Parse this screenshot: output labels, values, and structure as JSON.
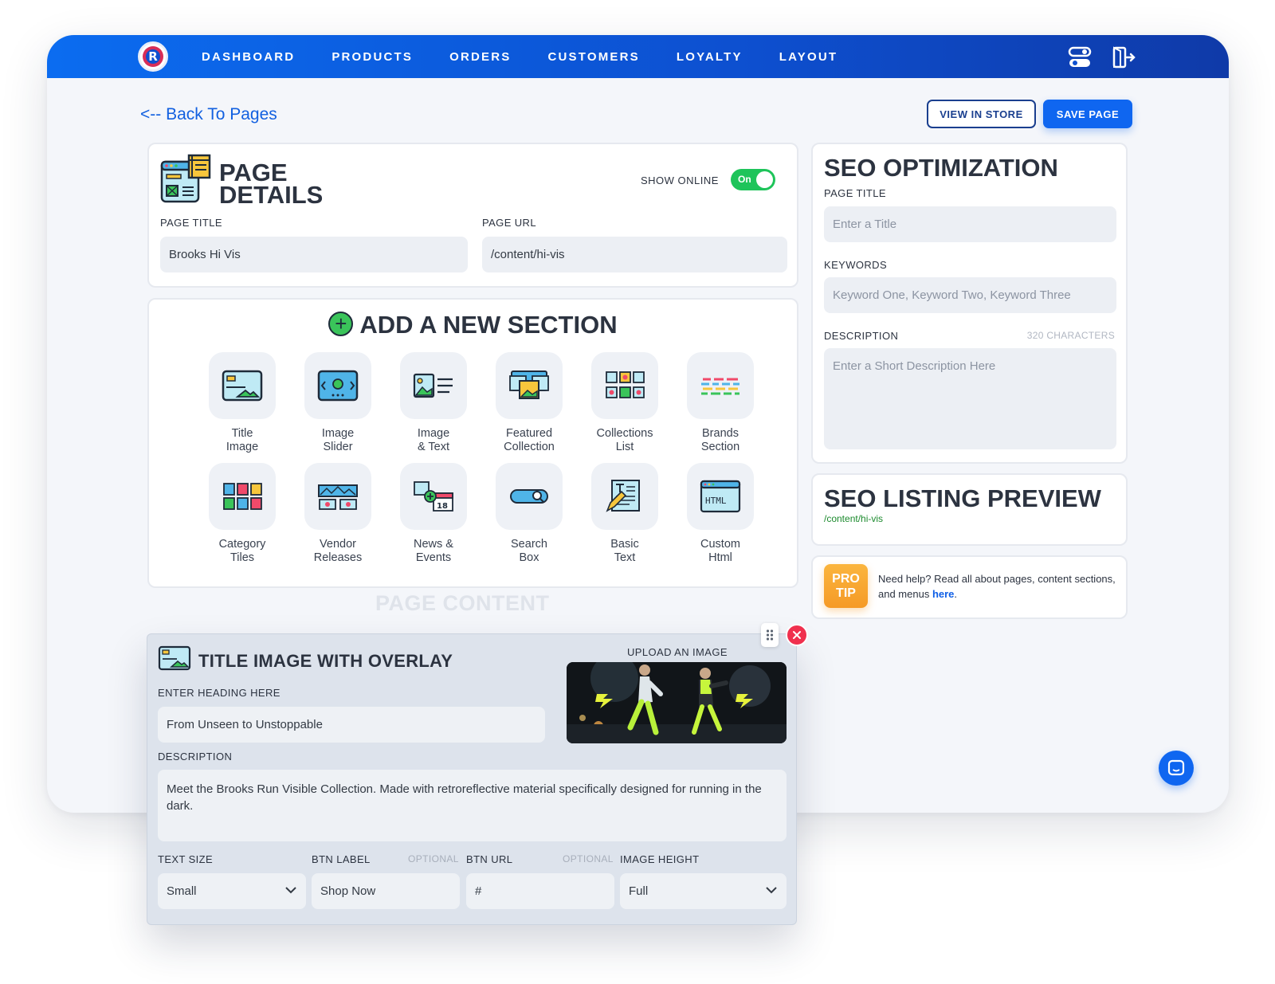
{
  "nav": {
    "items": [
      "DASHBOARD",
      "PRODUCTS",
      "ORDERS",
      "CUSTOMERS",
      "LOYALTY",
      "LAYOUT"
    ],
    "logo_letter": "R",
    "icons": [
      "settings-toggle-icon",
      "logout-icon"
    ]
  },
  "toolbar": {
    "back_label": "<-- Back To Pages",
    "view_label": "VIEW IN STORE",
    "save_label": "SAVE PAGE"
  },
  "page_details": {
    "title": "PAGE DETAILS",
    "show_online_label": "SHOW ONLINE",
    "toggle_label": "On",
    "toggle_state": true,
    "page_title_label": "PAGE TITLE",
    "page_title_value": "Brooks Hi Vis",
    "page_url_label": "PAGE URL",
    "page_url_value": "/content/hi-vis"
  },
  "add_section": {
    "title": "ADD A NEW SECTION",
    "tiles": [
      {
        "label": "Title\nImage",
        "icon": "title-image-icon"
      },
      {
        "label": "Image\nSlider",
        "icon": "image-slider-icon"
      },
      {
        "label": "Image\n& Text",
        "icon": "image-text-icon"
      },
      {
        "label": "Featured\nCollection",
        "icon": "featured-collection-icon"
      },
      {
        "label": "Collections\nList",
        "icon": "collections-list-icon"
      },
      {
        "label": "Brands\nSection",
        "icon": "brands-section-icon"
      },
      {
        "label": "Category\nTiles",
        "icon": "category-tiles-icon"
      },
      {
        "label": "Vendor\nReleases",
        "icon": "vendor-releases-icon"
      },
      {
        "label": "News &\nEvents",
        "icon": "news-events-icon"
      },
      {
        "label": "Search\nBox",
        "icon": "search-box-icon"
      },
      {
        "label": "Basic\nText",
        "icon": "basic-text-icon"
      },
      {
        "label": "Custom\nHtml",
        "icon": "custom-html-icon"
      }
    ]
  },
  "page_content_label": "PAGE CONTENT",
  "section_panel": {
    "title": "TITLE IMAGE WITH OVERLAY",
    "upload_label": "UPLOAD AN IMAGE",
    "heading_label": "ENTER HEADING HERE",
    "heading_value": "From Unseen to Unstoppable",
    "description_label": "DESCRIPTION",
    "description_value": "Meet the Brooks Run Visible Collection. Made with retroreflective material specifically designed for running in the dark.",
    "text_size_label": "TEXT SIZE",
    "text_size_value": "Small",
    "btn_label_label": "BTN LABEL",
    "btn_label_value": "Shop Now",
    "btn_url_label": "BTN URL",
    "btn_url_value": "#",
    "optional_label": "OPTIONAL",
    "image_height_label": "IMAGE HEIGHT",
    "image_height_value": "Full"
  },
  "seo": {
    "title": "SEO OPTIMIZATION",
    "page_title_label": "PAGE TITLE",
    "page_title_placeholder": "Enter a Title",
    "keywords_label": "KEYWORDS",
    "keywords_placeholder": "Keyword One, Keyword Two, Keyword Three",
    "description_label": "DESCRIPTION",
    "char_count": "320 CHARACTERS",
    "description_placeholder": "Enter a Short Description Here"
  },
  "seo_preview": {
    "title": "SEO LISTING PREVIEW",
    "url": "/content/hi-vis"
  },
  "pro_tip": {
    "badge": "PRO\nTIP",
    "text": "Need help? Read all about pages, content sections, and menus ",
    "link": "here",
    "suffix": "."
  },
  "colors": {
    "nav_start": "#0b6cf0",
    "nav_end": "#0f3aa8",
    "primary": "#0f66f0",
    "toggle_on": "#1ec45a",
    "pro_tip": "#f59a26",
    "close": "#f0304e"
  }
}
